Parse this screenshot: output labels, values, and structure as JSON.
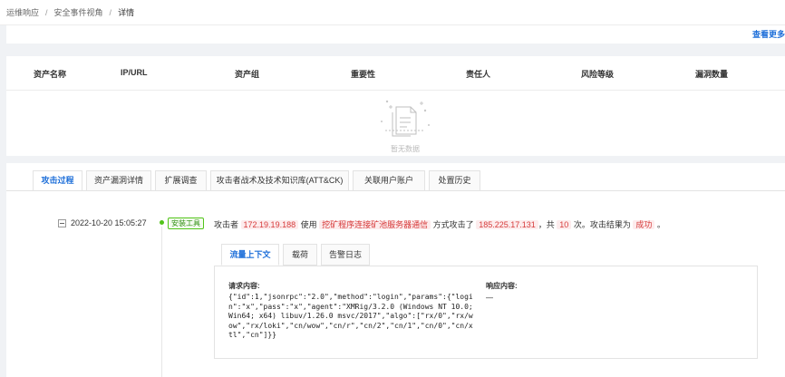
{
  "breadcrumb": {
    "items": [
      "运维响应",
      "安全事件视角"
    ],
    "current": "详情"
  },
  "top": {
    "view_more": "查看更多"
  },
  "assets_table": {
    "columns": [
      "资产名称",
      "IP/URL",
      "资产组",
      "重要性",
      "责任人",
      "风险等级",
      "漏洞数量"
    ],
    "empty_text": "暂无数据"
  },
  "tabs": [
    "攻击过程",
    "资产漏洞详情",
    "扩展调查",
    "攻击者战术及技术知识库(ATT&CK)",
    "关联用户账户",
    "处置历史"
  ],
  "event": {
    "time": "2022-10-20 15:05:27",
    "tool_tag": "安装工具",
    "sentence": {
      "p1": "攻击者",
      "attacker_ip": "172.19.19.188",
      "p2": "使用",
      "method": "挖矿程序连接矿池服务器通信",
      "p3": "方式攻击了",
      "target_ip": "185.225.17.131",
      "p4": "，共",
      "count": "10",
      "p5": "次。攻击结果为",
      "result": "成功",
      "p6": "。"
    },
    "sub_tabs": [
      "流量上下文",
      "载荷",
      "告警日志"
    ],
    "request_label": "请求内容:",
    "request_content": "{\"id\":1,\"jsonrpc\":\"2.0\",\"method\":\"login\",\"params\":{\"login\":\"x\",\"pass\":\"x\",\"agent\":\"XMRig/3.2.0 (Windows NT 10.0; Win64; x64) libuv/1.26.0 msvc/2017\",\"algo\":[\"rx/0\",\"rx/wow\",\"rx/loki\",\"cn/wow\",\"cn/r\",\"cn/2\",\"cn/1\",\"cn/0\",\"cn/xtl\",\"cn\"]}}",
    "response_label": "响应内容:",
    "response_content": "—"
  }
}
